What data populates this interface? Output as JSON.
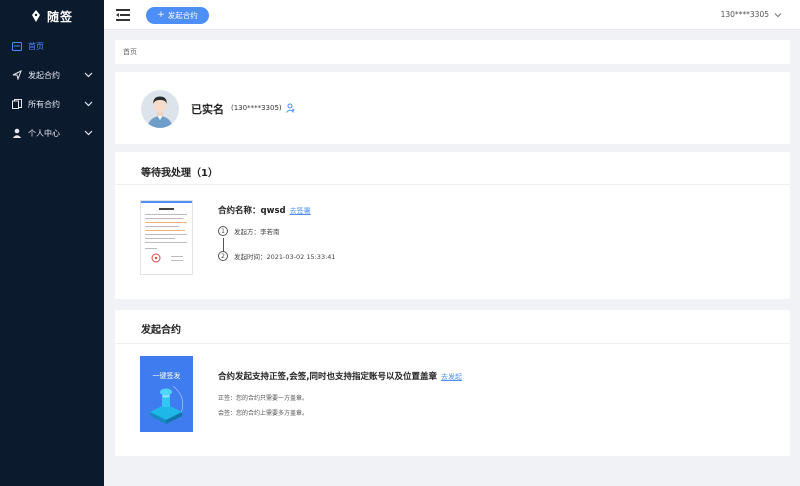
{
  "app": {
    "logo_text": "随签",
    "accent": "#4d8ff7",
    "sidebar_bg": "#0c1a2e"
  },
  "sidebar": {
    "items": [
      {
        "label": "首页",
        "icon": "home-card-icon",
        "active": true
      },
      {
        "label": "发起合约",
        "icon": "send-arrow-icon",
        "expandable": true
      },
      {
        "label": "所有合约",
        "icon": "documents-icon",
        "expandable": true
      },
      {
        "label": "个人中心",
        "icon": "user-icon",
        "expandable": true
      }
    ]
  },
  "topbar": {
    "menu_icon": "hamburger-icon",
    "launch_button": "发起合约",
    "account": "130****3305"
  },
  "breadcrumb": {
    "current": "首页"
  },
  "profile": {
    "status": "已实名",
    "phone": "(130****3305)",
    "action_icon": "person-settings-icon"
  },
  "pending": {
    "title": "等待我处理（1）",
    "contract_label": "合约名称：",
    "contract_name": "qwsd",
    "action_link": "去签署",
    "steps": [
      {
        "num": "1",
        "text": "发起方：李若南"
      },
      {
        "num": "2",
        "text": "发起时间：2021-03-02 15:33:41"
      }
    ]
  },
  "launch": {
    "title": "发起合约",
    "promo_label": "一键签发",
    "support_text": "合约发起支持正签,会签,同时也支持指定账号以及位置盖章",
    "action_link": "去发起",
    "notes": [
      "正签：您的合约只需要一方盖章。",
      "会签：您的合约上需要多方盖章。"
    ]
  }
}
